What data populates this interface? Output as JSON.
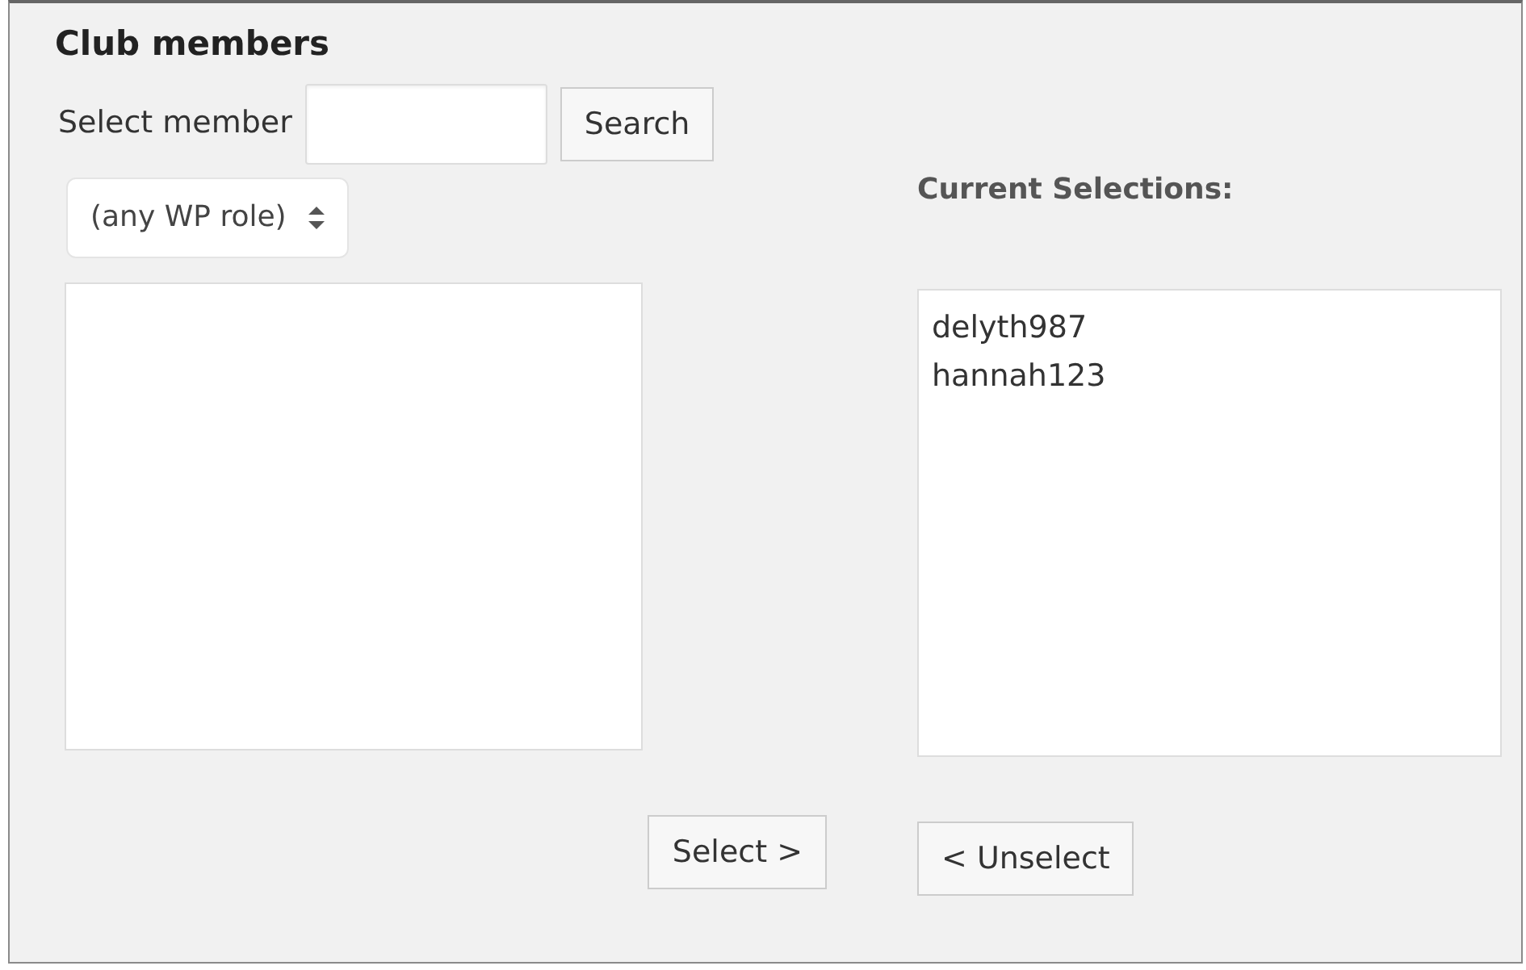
{
  "title": "Club members",
  "search": {
    "label": "Select member",
    "button": "Search"
  },
  "role_filter": {
    "value": "(any WP role)"
  },
  "available": {
    "button": "Select >"
  },
  "current": {
    "heading": "Current Selections:",
    "items": [
      {
        "label": "delyth987"
      },
      {
        "label": "hannah123"
      }
    ],
    "button": "< Unselect"
  }
}
